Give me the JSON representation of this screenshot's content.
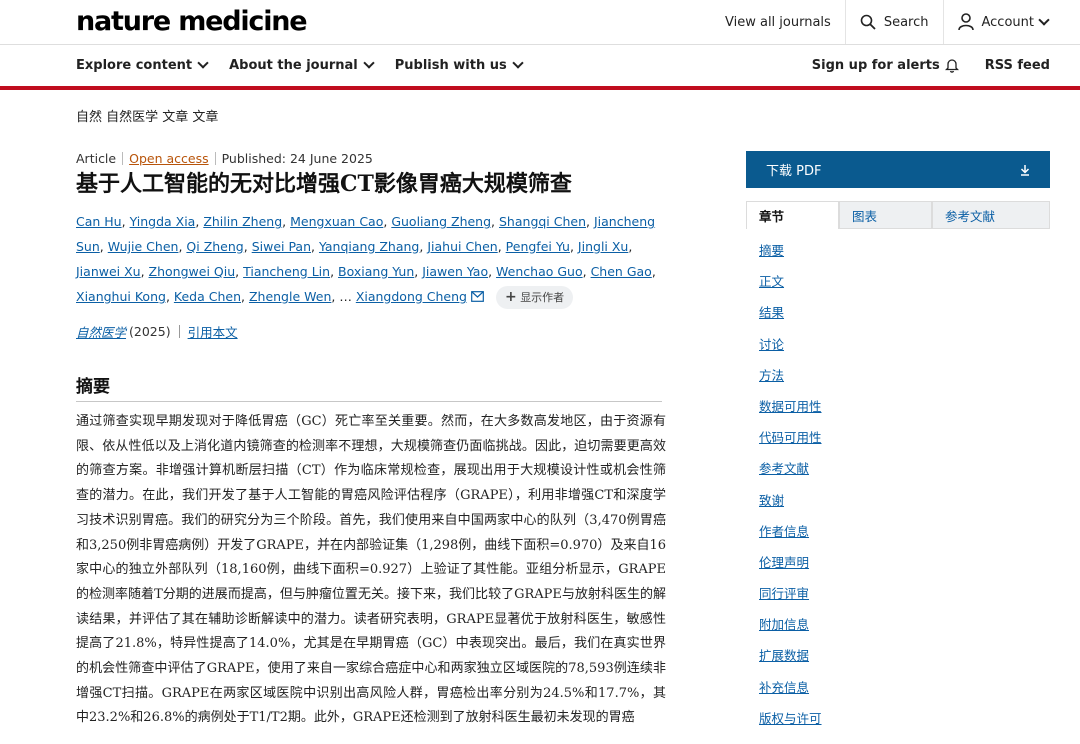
{
  "header": {
    "logo": "nature medicine",
    "view_all_journals": "View all journals",
    "search_label": "Search",
    "account_label": "Account"
  },
  "nav": {
    "explore": "Explore content",
    "about": "About the journal",
    "publish": "Publish with us",
    "alerts": "Sign up for alerts",
    "rss": "RSS feed"
  },
  "breadcrumb": "自然 自然医学 文章 文章",
  "article": {
    "type": "Article",
    "open_access": "Open access",
    "published": "Published: 24 June 2025",
    "title": "基于人工智能的无对比增强CT影像胃癌大规模筛查",
    "authors": [
      "Can Hu",
      "Yingda Xia",
      "Zhilin Zheng",
      "Mengxuan Cao",
      "Guoliang Zheng",
      "Shangqi Chen",
      "Jiancheng Sun",
      "Wujie Chen",
      "Qi Zheng",
      "Siwei Pan",
      "Yanqiang Zhang",
      "Jiahui Chen",
      "Pengfei Yu",
      "Jingli Xu",
      "Jianwei Xu",
      "Zhongwei Qiu",
      "Tiancheng Lin",
      "Boxiang Yun",
      "Jiawen Yao",
      "Wenchao Guo",
      "Chen Gao",
      "Xianghui Kong",
      "Keda Chen",
      "Zhengle Wen"
    ],
    "authors_ellipsis": "…",
    "last_author": "Xiangdong Cheng",
    "show_authors": "显示作者",
    "journal": "自然医学",
    "year": "(2025)",
    "cite_link": "引用本文",
    "abstract_heading": "摘要",
    "abstract_text": "通过筛查实现早期发现对于降低胃癌（GC）死亡率至关重要。然而，在大多数高发地区，由于资源有限、依从性低以及上消化道内镜筛查的检测率不理想，大规模筛查仍面临挑战。因此，迫切需要更高效的筛查方案。非增强计算机断层扫描（CT）作为临床常规检查，展现出用于大规模设计性或机会性筛查的潜力。在此，我们开发了基于人工智能的胃癌风险评估程序（GRAPE），利用非增强CT和深度学习技术识别胃癌。我们的研究分为三个阶段。首先，我们使用来自中国两家中心的队列（3,470例胃癌和3,250例非胃癌病例）开发了GRAPE，并在内部验证集（1,298例，曲线下面积=0.970）及来自16家中心的独立外部队列（18,160例，曲线下面积=0.927）上验证了其性能。亚组分析显示，GRAPE的检测率随着T分期的进展而提高，但与肿瘤位置无关。接下来，我们比较了GRAPE与放射科医生的解读结果，并评估了其在辅助诊断解读中的潜力。读者研究表明，GRAPE显著优于放射科医生，敏感性提高了21.8%，特异性提高了14.0%，尤其是在早期胃癌（GC）中表现突出。最后，我们在真实世界的机会性筛查中评估了GRAPE，使用了来自一家综合癌症中心和两家独立区域医院的78,593例连续非增强CT扫描。GRAPE在两家区域医院中识别出高风险人群，胃癌检出率分别为24.5%和17.7%，其中23.2%和26.8%的病例处于T1/T2期。此外，GRAPE还检测到了放射科医生最初未发现的胃癌"
  },
  "sidebar": {
    "download": "下载 PDF",
    "tabs": [
      "章节",
      "图表",
      "参考文献"
    ],
    "toc": [
      "摘要",
      "正文",
      "结果",
      "讨论",
      "方法",
      "数据可用性",
      "代码可用性",
      "参考文献",
      "致谢",
      "作者信息",
      "伦理声明",
      "同行评审",
      "附加信息",
      "扩展数据",
      "补充信息",
      "版权与许可"
    ]
  }
}
